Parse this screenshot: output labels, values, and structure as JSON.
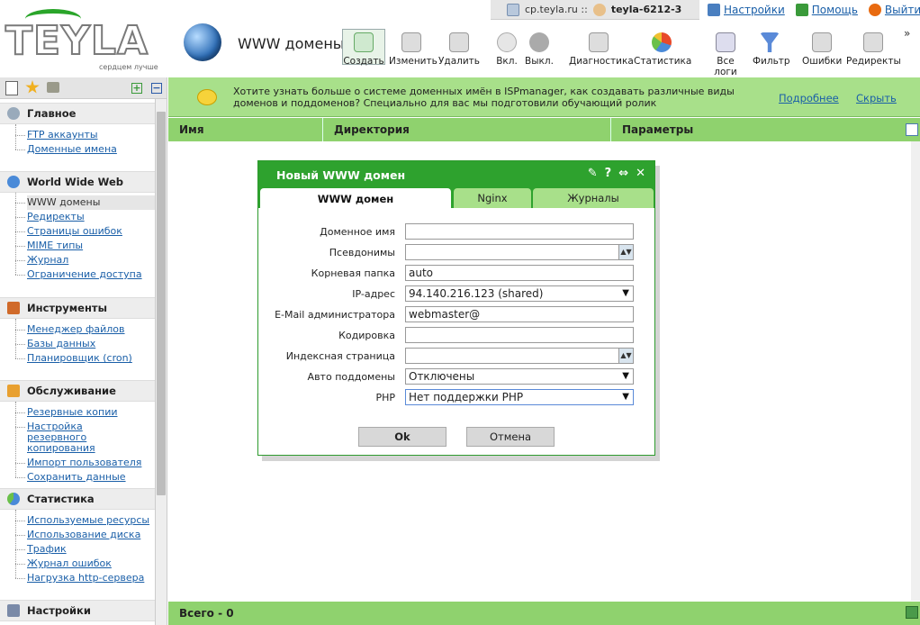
{
  "topbar": {
    "host": "cp.teyla.ru ::",
    "user": "teyla-6212-3"
  },
  "toplinks": {
    "settings": "Настройки",
    "help": "Помощь",
    "logout": "Выйти"
  },
  "logo": {
    "word": "TEYLA",
    "tagline": "сердцем лучше"
  },
  "page_title": "WWW домены",
  "toolbar": [
    {
      "label": "Создать",
      "icon": "create-icon"
    },
    {
      "label": "Изменить",
      "icon": "edit-icon"
    },
    {
      "label": "Удалить",
      "icon": "delete-icon"
    },
    {
      "label": "Вкл.",
      "icon": "bulb-on-icon"
    },
    {
      "label": "Выкл.",
      "icon": "bulb-off-icon"
    },
    {
      "label": "Диагностика",
      "icon": "diagnostics-icon"
    },
    {
      "label": "Статистика",
      "icon": "pie-chart-icon"
    },
    {
      "label": "Все логи",
      "icon": "logs-icon"
    },
    {
      "label": "Фильтр",
      "icon": "filter-icon"
    },
    {
      "label": "Ошибки",
      "icon": "errors-icon"
    },
    {
      "label": "Редиректы",
      "icon": "redirect-icon"
    }
  ],
  "overflow": "»",
  "sidebar": {
    "sections": [
      {
        "title": "Главное",
        "items": [
          "FTP аккаунты",
          "Доменные имена"
        ]
      },
      {
        "title": "World Wide Web",
        "items": [
          "WWW домены",
          "Редиректы",
          "Страницы ошибок",
          "MIME типы",
          "Журнал",
          "Ограничение доступа"
        ]
      },
      {
        "title": "Инструменты",
        "items": [
          "Менеджер файлов",
          "Базы данных",
          "Планировщик (cron)"
        ]
      },
      {
        "title": "Обслуживание",
        "items": [
          "Резервные копии",
          "Настройка резервного копирования",
          "Импорт пользователя",
          "Сохранить данные"
        ]
      },
      {
        "title": "Статистика",
        "items": [
          "Используемые ресурсы",
          "Использование диска",
          "Трафик",
          "Журнал ошибок",
          "Нагрузка http-сервера"
        ]
      },
      {
        "title": "Настройки",
        "items": []
      }
    ]
  },
  "banner": {
    "text": "Хотите узнать больше о системе доменных имён в ISPmanager, как создавать различные виды доменов и поддоменов? Специально для вас мы подготовили обучающий ролик",
    "more": "Подробнее",
    "hide": "Скрыть"
  },
  "grid": {
    "columns": [
      "Имя",
      "Директория",
      "Параметры"
    ],
    "footer": "Всего - 0"
  },
  "dialog": {
    "title": "Новый WWW домен",
    "tabs": [
      "WWW домен",
      "Nginx",
      "Журналы"
    ],
    "fields": [
      {
        "label": "Доменное имя",
        "value": ""
      },
      {
        "label": "Псевдонимы",
        "value": ""
      },
      {
        "label": "Корневая папка",
        "value": "auto"
      },
      {
        "label": "IP-адрес",
        "value": "94.140.216.123 (shared)"
      },
      {
        "label": "E-Mail администратора",
        "value": "webmaster@"
      },
      {
        "label": "Кодировка",
        "value": ""
      },
      {
        "label": "Индексная страница",
        "value": ""
      },
      {
        "label": "Авто поддомены",
        "value": "Отключены"
      },
      {
        "label": "PHP",
        "value": "Нет поддержки PHP"
      }
    ],
    "ok": "Ok",
    "cancel": "Отмена"
  }
}
